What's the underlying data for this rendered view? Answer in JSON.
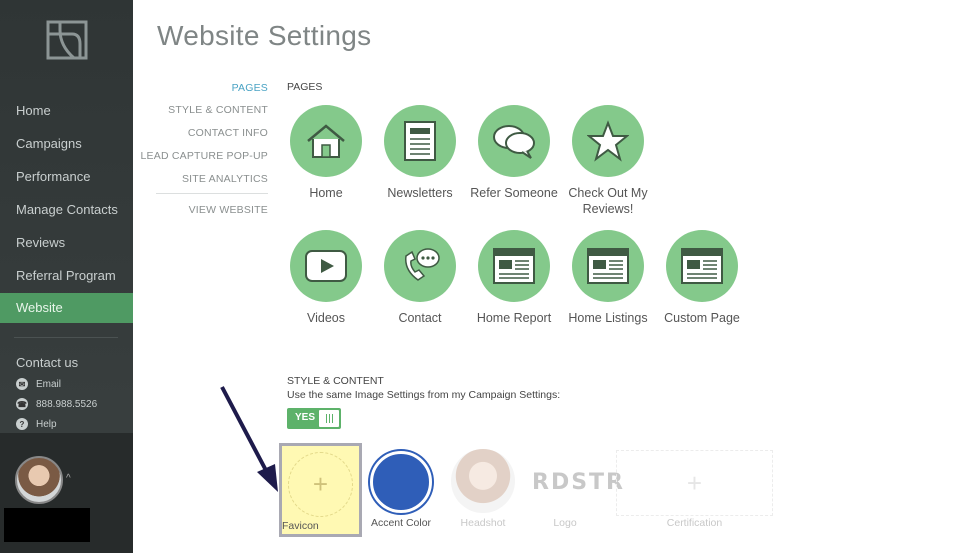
{
  "sidebar": {
    "items": [
      {
        "label": "Home"
      },
      {
        "label": "Campaigns"
      },
      {
        "label": "Performance"
      },
      {
        "label": "Manage Contacts"
      },
      {
        "label": "Reviews"
      },
      {
        "label": "Referral Program"
      },
      {
        "label": "Website",
        "active": true
      }
    ],
    "contact_title": "Contact us",
    "contact": [
      {
        "icon": "mail-icon",
        "label": "Email"
      },
      {
        "icon": "phone-icon",
        "label": "888.988.5526"
      },
      {
        "icon": "help-icon",
        "label": "Help"
      }
    ]
  },
  "header": {
    "title": "Website Settings"
  },
  "subnav": {
    "items": [
      {
        "label": "PAGES",
        "active": true
      },
      {
        "label": "STYLE & CONTENT"
      },
      {
        "label": "CONTACT INFO"
      },
      {
        "label": "LEAD CAPTURE POP-UP"
      },
      {
        "label": "SITE ANALYTICS"
      },
      {
        "label": "VIEW WEBSITE"
      }
    ]
  },
  "pages_section": {
    "label": "PAGES",
    "tiles": [
      {
        "label": "Home",
        "icon": "house-icon"
      },
      {
        "label": "Newsletters",
        "icon": "newsletter-icon"
      },
      {
        "label": "Refer Someone",
        "icon": "chat-bubbles-icon"
      },
      {
        "label": "Check Out My Reviews!",
        "icon": "star-icon"
      },
      {
        "label": "Videos",
        "icon": "play-icon"
      },
      {
        "label": "Contact",
        "icon": "phone-chat-icon"
      },
      {
        "label": "Home Report",
        "icon": "browser-page-icon"
      },
      {
        "label": "Home Listings",
        "icon": "browser-page-icon"
      },
      {
        "label": "Custom Page",
        "icon": "browser-page-icon"
      }
    ]
  },
  "style_section": {
    "label": "STYLE & CONTENT",
    "same_settings_text": "Use the same Image Settings from my Campaign Settings:",
    "toggle_label": "YES",
    "toggle_on": true,
    "assets": {
      "favicon": "Favicon",
      "accent_color": "Accent Color",
      "headshot": "Headshot",
      "logo": "Logo",
      "logo_text": "RDSTR",
      "certification": "Certification"
    },
    "accent_hex": "#2f5eb8"
  },
  "colors": {
    "brand_green": "#84c98b",
    "active_nav": "#4f9a63",
    "sidebar_bg": "#2f3535"
  }
}
